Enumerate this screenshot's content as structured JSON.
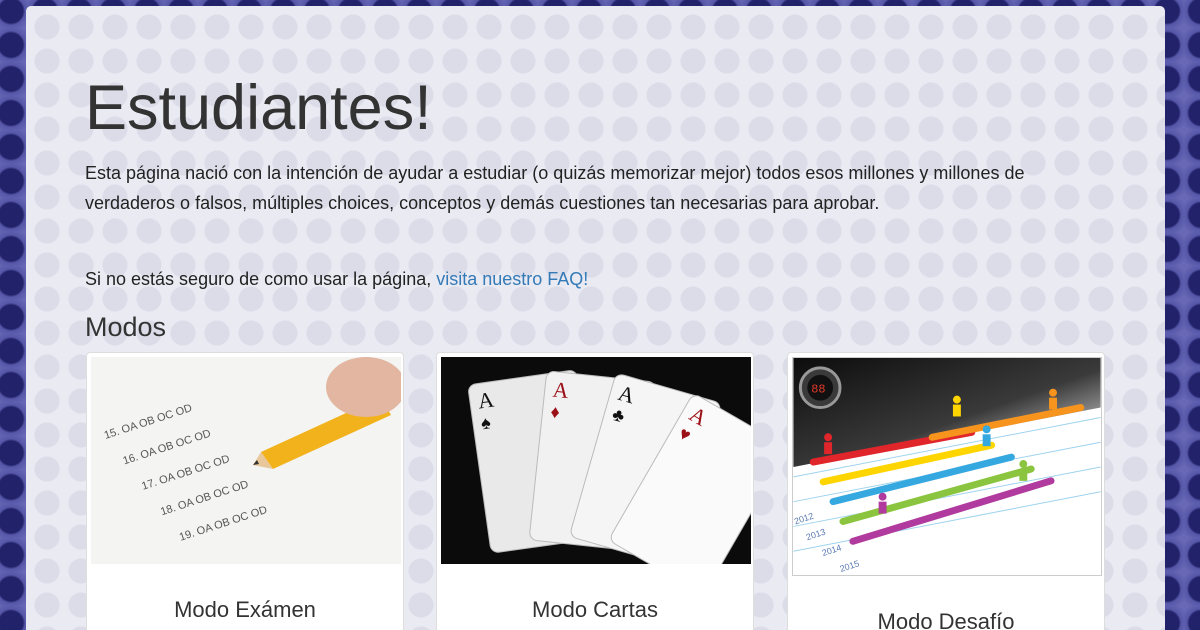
{
  "header": {
    "title": "Estudiantes!",
    "intro": "Esta página nació con la intención de ayudar a estudiar (o quizás memorizar mejor) todos esos millones y millones de verdaderos o falsos, múltiples choices, conceptos y demás cuestiones tan necesarias para aprobar.",
    "faq_prefix": "Si no estás seguro de como usar la página, ",
    "faq_link": "visita nuestro FAQ!"
  },
  "modes": {
    "title": "Modos",
    "cards": [
      {
        "label": "Modo Exámen",
        "image": "exam-answer-sheet-image",
        "sheet_lines": [
          "15. OA OB OC OD",
          "16. OA OB OC OD",
          "17. OA OB OC OD",
          "18. OA OB OC OD",
          "19. OA OB OC OD"
        ]
      },
      {
        "label": "Modo Cartas",
        "image": "playing-cards-image",
        "card_rank": "A"
      },
      {
        "label": "Modo Desafío",
        "image": "challenge-race-image",
        "timer": "88",
        "years": [
          "2012",
          "2013",
          "2014",
          "2015"
        ]
      }
    ]
  },
  "colors": {
    "link": "#337ab7",
    "background": "#4a4a9c",
    "panel": "#eaeaf3"
  }
}
